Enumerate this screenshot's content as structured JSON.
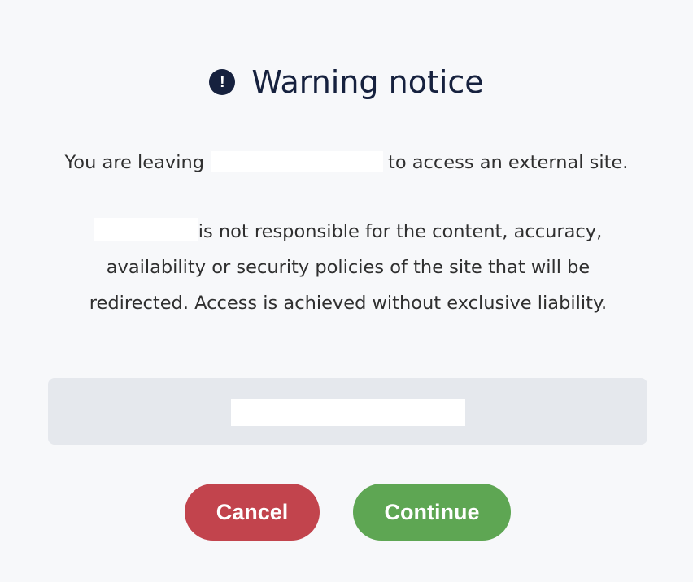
{
  "dialog": {
    "icon": "exclamation-circle-icon",
    "icon_glyph": "!",
    "title": "Warning notice",
    "leaving_prefix": "You are leaving",
    "leaving_suffix": "to access an external site.",
    "disclaimer": "is not responsible for the content, accuracy, availability or security policies of the site that will be redirected. Access is achieved without exclusive liability."
  },
  "buttons": {
    "cancel_label": "Cancel",
    "continue_label": "Continue"
  },
  "colors": {
    "title": "#16213e",
    "cancel": "#c2444d",
    "continue": "#5ea653",
    "url_box": "#e5e8ed",
    "background": "#f7f8fa"
  }
}
